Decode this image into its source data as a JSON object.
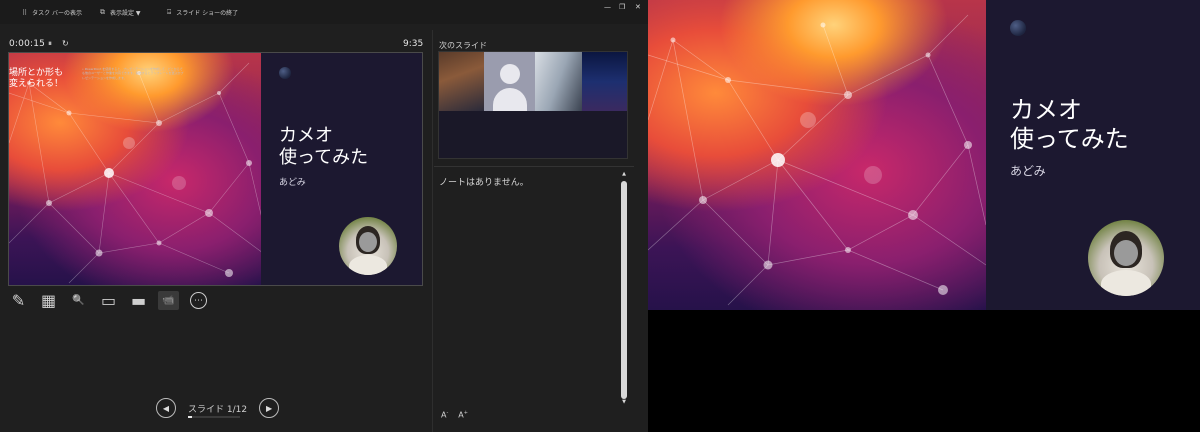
{
  "topbar": {
    "taskbar_label": "タスク バーの表示",
    "display_settings_label": "表示設定 ▼",
    "end_show_label": "スライド ショーの終了",
    "minimize_glyph": "—",
    "restore_glyph": "❐",
    "close_glyph": "✕"
  },
  "presenter": {
    "timer": "0:00:15",
    "pause_glyph": "⏸",
    "reset_glyph": "↻",
    "clock": "9:35"
  },
  "slide": {
    "title_line1": "カメオ",
    "title_line2": "使ってみた",
    "subtitle": "あどみ"
  },
  "tools": [
    {
      "name": "pen-tool-icon",
      "glyph": "✎"
    },
    {
      "name": "all-slides-icon",
      "glyph": "▦"
    },
    {
      "name": "zoom-icon",
      "glyph": "🔍"
    },
    {
      "name": "black-screen-icon",
      "glyph": "▭"
    },
    {
      "name": "subtitles-icon",
      "glyph": "▬"
    },
    {
      "name": "camera-icon",
      "glyph": "📹"
    },
    {
      "name": "more-options-icon",
      "glyph": "⋯"
    }
  ],
  "navigation": {
    "prev_glyph": "◀",
    "next_glyph": "▶",
    "slide_counter": "スライド 1/12",
    "progress": 0.083
  },
  "next_slide": {
    "label": "次のスライド",
    "title_line1": "場所とか形も",
    "title_line2": "変えられる！",
    "body": "• PowerPoint を使用すると、プレゼンテーションを作成して、どこからでも他のユーザーと作業を共有できます。開始するとテンプレートを選ぶかプレゼンテーションを作成します。"
  },
  "notes": {
    "text": "ノートはありません。",
    "font_decrease": "A",
    "font_increase": "A"
  },
  "colors": {
    "panel_bg": "#1c1830",
    "window_bg": "#1f1f1f",
    "accent": "#c8286a"
  }
}
